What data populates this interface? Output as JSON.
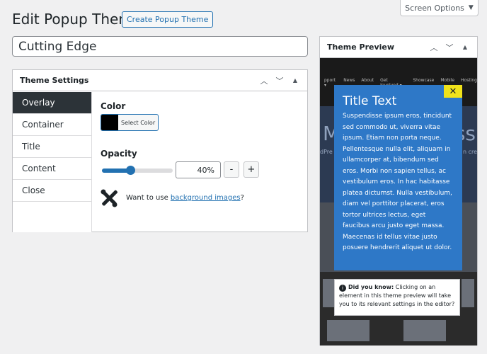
{
  "screen_options": {
    "label": "Screen Options"
  },
  "header": {
    "title": "Edit Popup Theme",
    "create_button": "Create Popup Theme"
  },
  "theme_title_value": "Cutting Edge",
  "theme_settings": {
    "title": "Theme Settings",
    "tabs": [
      {
        "label": "Overlay",
        "active": true
      },
      {
        "label": "Container",
        "active": false
      },
      {
        "label": "Title",
        "active": false
      },
      {
        "label": "Content",
        "active": false
      },
      {
        "label": "Close",
        "active": false
      }
    ],
    "overlay": {
      "color_label": "Color",
      "color_button_label": "Select Color",
      "color_value": "#000000",
      "opacity_label": "Opacity",
      "opacity_value": "40%",
      "opacity_fraction": 0.4,
      "minus_label": "-",
      "plus_label": "+",
      "background_text_prefix": "Want to use ",
      "background_link": "background images",
      "background_text_suffix": "?"
    }
  },
  "theme_preview": {
    "title": "Theme Preview",
    "site_nav": [
      "pport ▾",
      "News",
      "About",
      "Get Involved ▾",
      "Showcase",
      "Mobile",
      "Hosting"
    ],
    "bg_big_left": "M",
    "bg_big_right": "ss",
    "bg_small_left": "dPre",
    "bg_small_right": "n cre",
    "popup": {
      "title": "Title Text",
      "body": "Suspendisse ipsum eros, tincidunt sed commodo ut, viverra vitae ipsum. Etiam non porta neque. Pellentesque nulla elit, aliquam in ullamcorper at, bibendum sed eros. Morbi non sapien tellus, ac vestibulum eros. In hac habitasse platea dictumst. Nulla vestibulum, diam vel porttitor placerat, eros tortor ultrices lectus, eget faucibus arcu justo eget massa. Maecenas id tellus vitae justo posuere hendrerit aliquet ut dolor.",
      "close_symbol": "✕"
    },
    "notice": {
      "bold": "Did you know:",
      "text": " Clicking on an element in this theme preview will take you to its relevant settings in the editor?"
    }
  },
  "colors": {
    "accent": "#2271b1",
    "popup_bg": "#2e78c7",
    "close_bg": "#f0e21a",
    "active_tab": "#2c3338"
  }
}
